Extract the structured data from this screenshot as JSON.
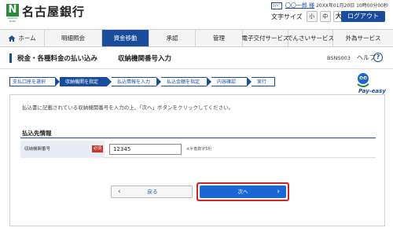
{
  "header": {
    "logo_mark": "N",
    "logo_sub": "NAGOYA BANK",
    "bank_name": "名古屋銀行",
    "user_tag": "ﾏｲﾍﾟ",
    "user_name": "〇〇一郎 様",
    "last_login": "20XX年01月20日 10時00分00秒",
    "font_size_label": "文字サイズ",
    "font_sizes": [
      "小",
      "中",
      "大"
    ],
    "logout_label": "ログアウト"
  },
  "nav": {
    "items": [
      {
        "label": "ホーム"
      },
      {
        "label": "明細照会"
      },
      {
        "label": "資金移動"
      },
      {
        "label": "承認"
      },
      {
        "label": "管理"
      },
      {
        "label": "電子交付サービス"
      },
      {
        "label": "でんさいサービス"
      },
      {
        "label": "外為サービス"
      }
    ],
    "active_index": 2
  },
  "page": {
    "title_main": "税金・各種料金の払い込み",
    "title_sub": "収納機関番号入力",
    "screen_id": "BSNS003",
    "help_label": "ヘルプ",
    "help_icon": "?"
  },
  "steps": [
    {
      "label": "支払口座を選択"
    },
    {
      "label": "収納機関を指定"
    },
    {
      "label": "払込情報を入力"
    },
    {
      "label": "払込金額を指定"
    },
    {
      "label": "内容確認"
    },
    {
      "label": "実行"
    }
  ],
  "mascot": {
    "text": "Pay-easy"
  },
  "content": {
    "instruction": "払込書に記載されている収納機関番号を入力の上、「次へ」ボタンをクリックしてください。",
    "section_title": "払込先情報",
    "field_label": "収納機関番号",
    "required_label": "必須",
    "field_value": "12345",
    "field_hint": "※半角数字5桁",
    "back_label": "戻る",
    "next_label": "次へ"
  },
  "colors": {
    "brand": "#1a4c9c",
    "next_button": "#1a68d6",
    "highlight": "#d0232b",
    "logo": "#2a8b3a"
  }
}
